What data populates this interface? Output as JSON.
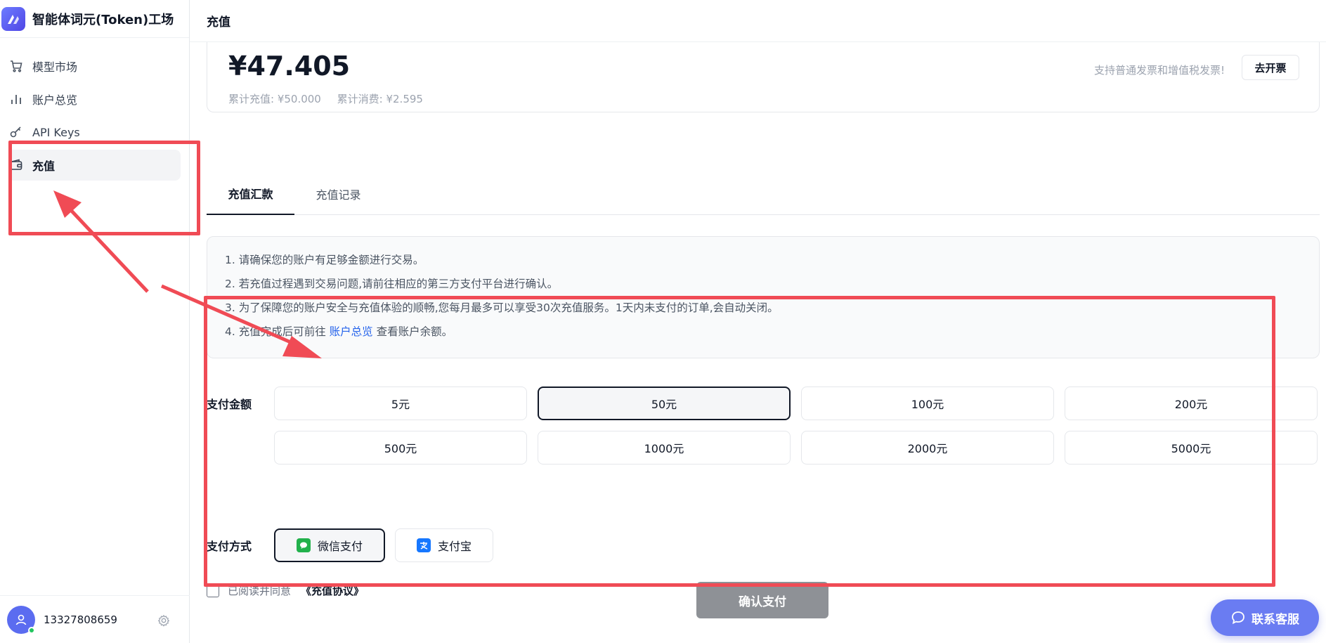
{
  "brand": {
    "logo_glyph": "⋌",
    "title": "智能体词元(Token)工场"
  },
  "sidebar": {
    "items": [
      {
        "label": "模型市场",
        "icon": "cart-icon",
        "active": false
      },
      {
        "label": "账户总览",
        "icon": "bar-chart-icon",
        "active": false
      },
      {
        "label": "API Keys",
        "icon": "key-icon",
        "active": false
      },
      {
        "label": "充值",
        "icon": "wallet-icon",
        "active": true
      }
    ]
  },
  "user": {
    "phone": "13327808659"
  },
  "header": {
    "title": "充值"
  },
  "balance": {
    "amount": "¥47.405",
    "total_recharge": "累计充值: ¥50.000",
    "total_consume": "累计消费: ¥2.595",
    "invoice_note": "支持普通发票和增值税发票!",
    "invoice_button": "去开票"
  },
  "tabs": [
    {
      "label": "充值汇款",
      "active": true
    },
    {
      "label": "充值记录",
      "active": false
    }
  ],
  "notice": {
    "line1": "1. 请确保您的账户有足够金额进行交易。",
    "line2": "2. 若充值过程遇到交易问题,请前往相应的第三方支付平台进行确认。",
    "line3": "3. 为了保障您的账户安全与充值体验的顺畅,您每月最多可以享受30次充值服务。1天内未支付的订单,会自动关闭。",
    "line4_prefix": "4. 充值完成后可前往 ",
    "line4_link": "账户总览",
    "line4_suffix": " 查看账户余额。"
  },
  "payment": {
    "amount_label": "支付金额",
    "amounts": [
      "5元",
      "50元",
      "100元",
      "200元",
      "500元",
      "1000元",
      "2000元",
      "5000元"
    ],
    "selected_amount": "50元",
    "method_label": "支付方式",
    "methods": [
      {
        "label": "微信支付",
        "icon": "wechat-icon",
        "selected": true
      },
      {
        "label": "支付宝",
        "icon": "alipay-icon",
        "selected": false
      }
    ],
    "agree_text": "已阅读并同意",
    "agreement_link": "《充值协议》",
    "confirm_button": "确认支付"
  },
  "support": {
    "label": "联系客服"
  },
  "colors": {
    "annotation": "#f04b55",
    "accent": "#6a7cf2",
    "link": "#2563eb",
    "confirm_disabled": "#8e9196"
  }
}
